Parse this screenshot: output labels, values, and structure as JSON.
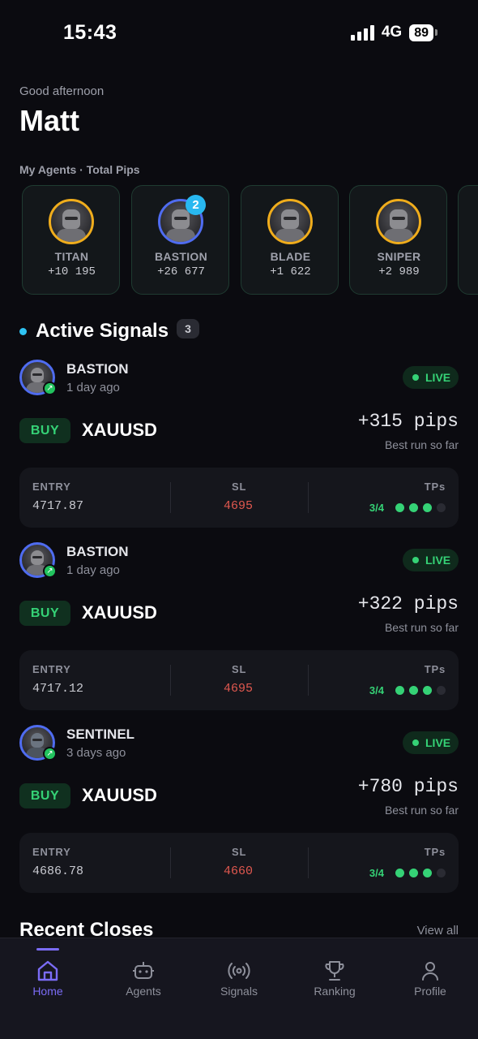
{
  "status_bar": {
    "time": "15:43",
    "network": "4G",
    "battery": "89"
  },
  "header": {
    "greeting": "Good afternoon",
    "name": "Matt",
    "agents_caption": "My Agents · Total Pips"
  },
  "agents": [
    {
      "name": "TITAN",
      "pips": "+10 195",
      "ring": "gold"
    },
    {
      "name": "BASTION",
      "pips": "+26 677",
      "ring": "blue",
      "badge": "2"
    },
    {
      "name": "BLADE",
      "pips": "+1 622",
      "ring": "gold"
    },
    {
      "name": "SNIPER",
      "pips": "+2 989",
      "ring": "gold"
    }
  ],
  "active_signals": {
    "title": "Active Signals",
    "count": "3",
    "items": [
      {
        "agent": "BASTION",
        "time": "1 day ago",
        "status": "LIVE",
        "side": "BUY",
        "symbol": "XAUUSD",
        "pips": "+315 pips",
        "run_note": "Best run so far",
        "entry_label": "ENTRY",
        "entry": "4717.87",
        "sl_label": "SL",
        "sl": "4695",
        "tps_label": "TPs",
        "tp_progress": "3/4",
        "tp_hit": 3,
        "tp_total": 4
      },
      {
        "agent": "BASTION",
        "time": "1 day ago",
        "status": "LIVE",
        "side": "BUY",
        "symbol": "XAUUSD",
        "pips": "+322 pips",
        "run_note": "Best run so far",
        "entry_label": "ENTRY",
        "entry": "4717.12",
        "sl_label": "SL",
        "sl": "4695",
        "tps_label": "TPs",
        "tp_progress": "3/4",
        "tp_hit": 3,
        "tp_total": 4
      },
      {
        "agent": "SENTINEL",
        "time": "3 days ago",
        "status": "LIVE",
        "side": "BUY",
        "symbol": "XAUUSD",
        "pips": "+780 pips",
        "run_note": "Best run so far",
        "entry_label": "ENTRY",
        "entry": "4686.78",
        "sl_label": "SL",
        "sl": "4660",
        "tps_label": "TPs",
        "tp_progress": "3/4",
        "tp_hit": 3,
        "tp_total": 4
      }
    ]
  },
  "recent_closes": {
    "title": "Recent Closes",
    "view_all": "View all"
  },
  "tab_bar": [
    {
      "label": "Home",
      "icon": "home-icon",
      "active": true
    },
    {
      "label": "Agents",
      "icon": "robot-icon",
      "active": false
    },
    {
      "label": "Signals",
      "icon": "broadcast-icon",
      "active": false
    },
    {
      "label": "Ranking",
      "icon": "trophy-icon",
      "active": false
    },
    {
      "label": "Profile",
      "icon": "user-icon",
      "active": false
    }
  ],
  "colors": {
    "accent": "#7b6cf6",
    "positive": "#35d276",
    "negative": "#e0584f",
    "gold_ring": "#f0ad1c",
    "blue_ring": "#4f6cf0",
    "dot_cyan": "#2fc3f3"
  }
}
